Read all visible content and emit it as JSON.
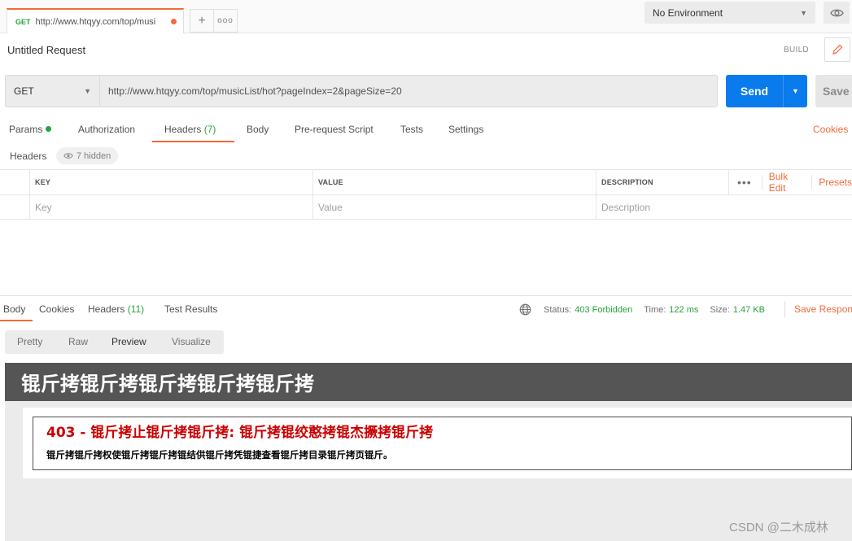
{
  "tabbar": {
    "tab_method": "GET",
    "tab_url": "http://www.htqyy.com/top/musi",
    "new_tab_icon": "plus-icon",
    "more_icon": "ellipsis-icon",
    "environment": "No Environment"
  },
  "request": {
    "title": "Untitled Request",
    "build_label": "BUILD",
    "method": "GET",
    "url": "http://www.htqyy.com/top/musicList/hot?pageIndex=2&pageSize=20",
    "send_label": "Send",
    "save_label": "Save"
  },
  "request_tabs": {
    "params": "Params",
    "authorization": "Authorization",
    "headers": "Headers",
    "headers_count": "(7)",
    "body": "Body",
    "prerequest": "Pre-request Script",
    "tests": "Tests",
    "settings": "Settings",
    "cookies": "Cookies"
  },
  "headers_section": {
    "label": "Headers",
    "hidden": "7 hidden"
  },
  "headers_table": {
    "columns": [
      "KEY",
      "VALUE",
      "DESCRIPTION"
    ],
    "placeholders": [
      "Key",
      "Value",
      "Description"
    ],
    "bulk_edit": "Bulk Edit",
    "presets": "Presets"
  },
  "response": {
    "tabs": {
      "body": "Body",
      "cookies": "Cookies",
      "headers": "Headers",
      "headers_count": "(11)",
      "test_results": "Test Results"
    },
    "status_label": "Status:",
    "status_value": "403 Forbidden",
    "time_label": "Time:",
    "time_value": "122 ms",
    "size_label": "Size:",
    "size_value": "1.47 KB",
    "save_response": "Save Response",
    "view_tabs": [
      "Pretty",
      "Raw",
      "Preview",
      "Visualize"
    ]
  },
  "preview": {
    "banner": "锟斤拷锟斤拷锟斤拷锟斤拷锟斤拷",
    "error_title": "403 - 锟斤拷止锟斤拷锟斤拷: 锟斤拷锟绞憨拷锟杰撅拷锟斤拷",
    "error_message": "锟斤拷锟斤拷权使锟斤拷锟斤拷锟结供锟斤拷凭锟捷查看锟斤拷目录锟斤拷页锟斤。"
  },
  "watermark": "CSDN @二木成林",
  "colors": {
    "accent": "#f26b3a",
    "send": "#097bed",
    "success": "#27a33d",
    "error": "#cc0000"
  }
}
